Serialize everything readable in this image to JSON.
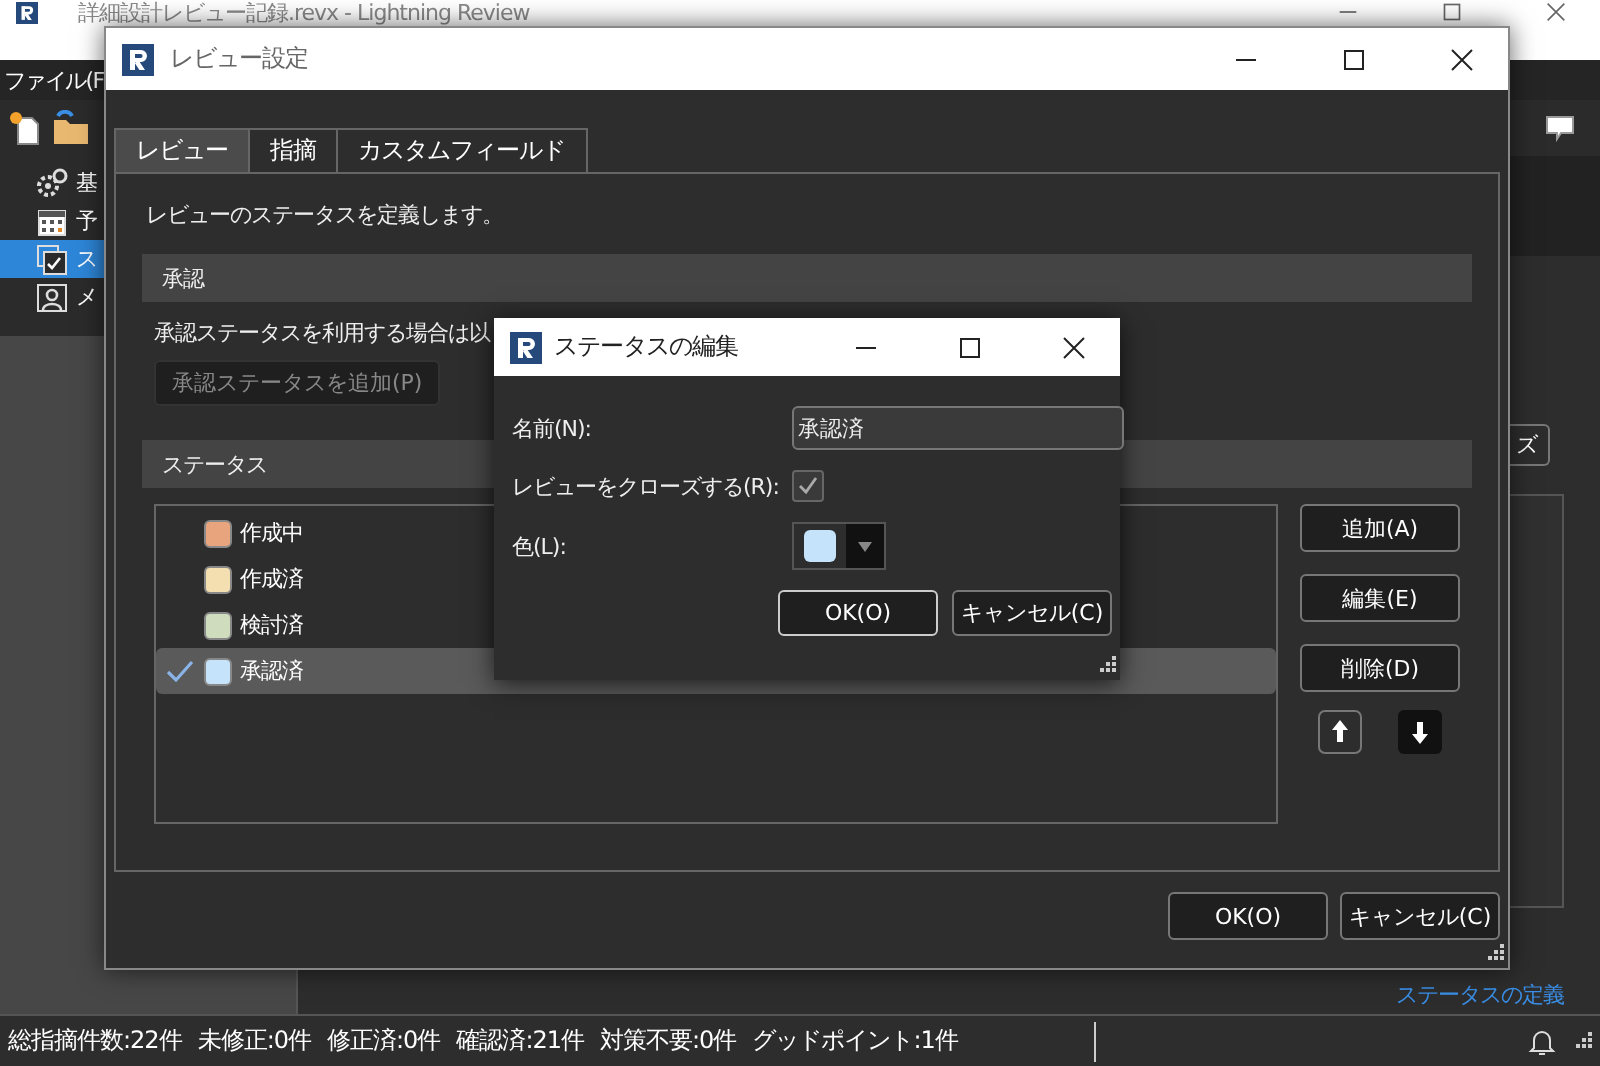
{
  "main_window": {
    "title": "詳細設計レビュー記録.revx - Lightning Review",
    "menu": [
      "ファイル(F"
    ],
    "sidebar_items": [
      {
        "label": "基",
        "selected": false
      },
      {
        "label": "予",
        "selected": false
      },
      {
        "label": "ス",
        "selected": true
      },
      {
        "label": "メ",
        "selected": false
      }
    ],
    "partial_button": "ズ",
    "link": "ステータスの定義"
  },
  "settings_dialog": {
    "title": "レビュー設定",
    "tabs": [
      {
        "label": "レビュー",
        "selected": true
      },
      {
        "label": "指摘",
        "selected": false
      },
      {
        "label": "カスタムフィールド",
        "selected": false
      }
    ],
    "description": "レビューのステータスを定義します。",
    "approval_section": {
      "heading": "承認",
      "text": "承認ステータスを利用する場合は以",
      "add_button": {
        "label": "承認ステータスを追加(P)",
        "disabled": true
      }
    },
    "status_section": {
      "heading": "ステータス",
      "statuses": [
        {
          "name": "作成中",
          "color": "#e8a47c",
          "closes_review": false,
          "selected": false
        },
        {
          "name": "作成済",
          "color": "#f3dfb0",
          "closes_review": false,
          "selected": false
        },
        {
          "name": "検討済",
          "color": "#cfdcbd",
          "closes_review": false,
          "selected": false
        },
        {
          "name": "承認済",
          "color": "#c5e3fa",
          "closes_review": true,
          "selected": true
        }
      ]
    },
    "side_buttons": [
      "追加(A)",
      "編集(E)",
      "削除(D)"
    ],
    "buttons": [
      "OK(O)",
      "キャンセル(C)"
    ]
  },
  "edit_dialog": {
    "title": "ステータスの編集",
    "name_label": "名前(N):",
    "name_value": "承認済",
    "close_label": "レビューをクローズする(R):",
    "close_checked": true,
    "color_label": "色(L):",
    "color": "#c5e3fa",
    "buttons": [
      "OK(O)",
      "キャンセル(C)"
    ]
  },
  "status_bar": {
    "counts": [
      "総指摘件数:22件",
      "未修正:0件",
      "修正済:0件",
      "確認済:21件",
      "対策不要:0件",
      "グッドポイント:1件"
    ]
  }
}
